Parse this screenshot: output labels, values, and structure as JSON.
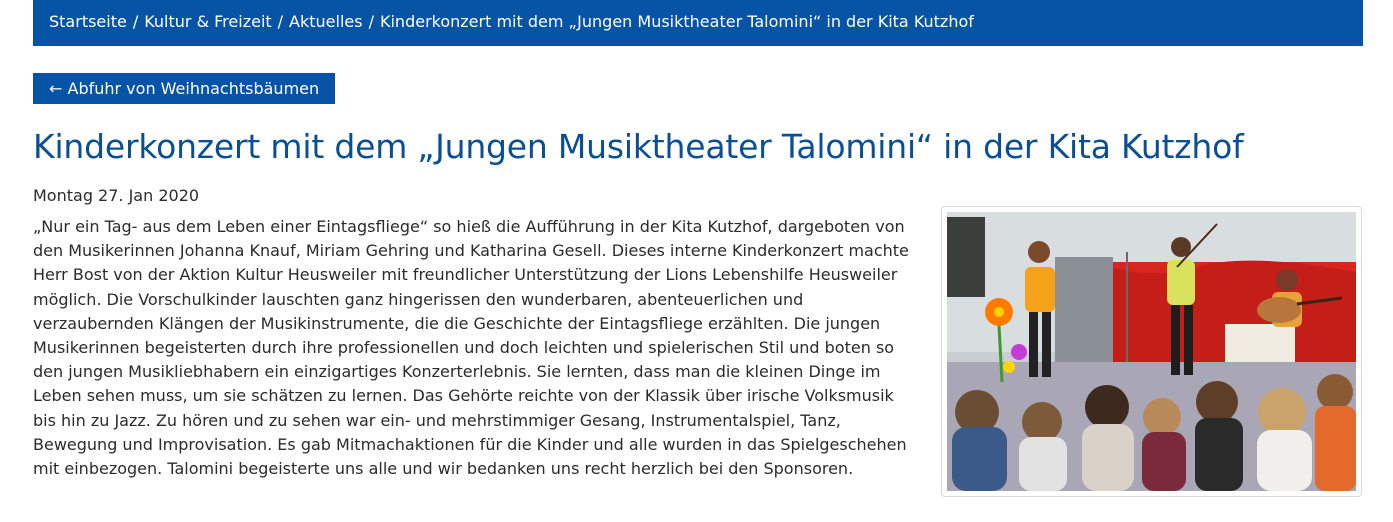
{
  "breadcrumb": {
    "items": [
      {
        "label": "Startseite"
      },
      {
        "label": "Kultur & Freizeit"
      },
      {
        "label": "Aktuelles"
      },
      {
        "label": "Kinderkonzert mit dem „Jungen Musiktheater Talomini“ in der Kita Kutzhof"
      }
    ],
    "separator": "/"
  },
  "nav": {
    "back_arrow": "←",
    "back_label": "Abfuhr von Weihnachtsbäumen"
  },
  "article": {
    "title": "Kinderkonzert mit dem „Jungen Musiktheater Talomini“ in der Kita Kutzhof",
    "date": "Montag 27. Jan 2020",
    "body": "„Nur ein Tag- aus dem Leben einer Eintagsfliege“ so hieß die Aufführung in der Kita Kutzhof, dargeboten von den Musikerinnen Johanna Knauf, Miriam Gehring und Katharina Gesell. Dieses interne Kinderkonzert machte Herr Bost von der  Aktion Kultur Heusweiler mit freundlicher Unterstützung der Lions Lebenshilfe Heusweiler möglich. Die Vorschulkinder lauschten ganz hingerissen den wunderbaren, abenteuerlichen und verzaubernden Klängen der Musikinstrumente, die die Geschichte der Eintagsfliege erzählten. Die jungen Musikerinnen begeisterten durch ihre professionellen und doch leichten und spielerischen Stil und  boten so den jungen Musikliebhabern ein einzigartiges Konzerterlebnis. Sie lernten, dass man die kleinen Dinge im Leben sehen muss, um sie schätzen zu lernen. Das Gehörte reichte von der Klassik über irische Volksmusik bis hin zu Jazz. Zu hören und zu sehen war ein- und mehrstimmiger Gesang, Instrumentalspiel, Tanz, Bewegung und Improvisation. Es gab Mitmachaktionen für die Kinder und alle wurden in das Spielgeschehen mit einbezogen. Talomini begeisterte uns alle und wir bedanken uns recht herzlich bei den Sponsoren."
  },
  "colors": {
    "brand_blue": "#0753a6",
    "title_blue": "#0a4f94",
    "text": "#2b2b2b"
  },
  "icons": {
    "back": "arrow-left-icon"
  }
}
